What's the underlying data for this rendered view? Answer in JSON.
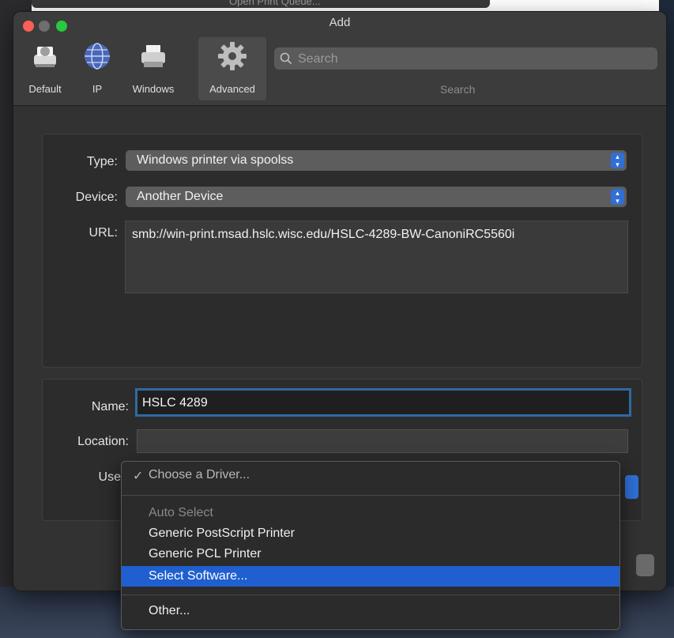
{
  "window": {
    "title": "Add"
  },
  "toolbar": {
    "tools": [
      {
        "label": "Default",
        "icon": "default-printer-icon"
      },
      {
        "label": "IP",
        "icon": "globe-icon"
      },
      {
        "label": "Windows",
        "icon": "windows-printer-icon"
      },
      {
        "label": "Advanced",
        "icon": "gear-icon"
      }
    ],
    "search_placeholder": "Search",
    "search_label": "Search"
  },
  "form": {
    "type_label": "Type:",
    "type_value": "Windows printer via spoolss",
    "device_label": "Device:",
    "device_value": "Another Device",
    "url_label": "URL:",
    "url_value": "smb://win-print.msad.hslc.wisc.edu/HSLC-4289-BW-CanoniRC5560i",
    "name_label": "Name:",
    "name_value": "HSLC 4289",
    "location_label": "Location:",
    "location_value": "",
    "use_label": "Use"
  },
  "driver_menu": {
    "choose": "Choose a Driver...",
    "auto_select": "Auto Select",
    "items": [
      "Generic PostScript Printer",
      "Generic PCL Printer",
      "Select Software..."
    ],
    "other": "Other..."
  },
  "colors": {
    "accent": "#1f5fd0",
    "stepper": "#2f6fd6",
    "focus_ring": "#2f6a9f"
  }
}
